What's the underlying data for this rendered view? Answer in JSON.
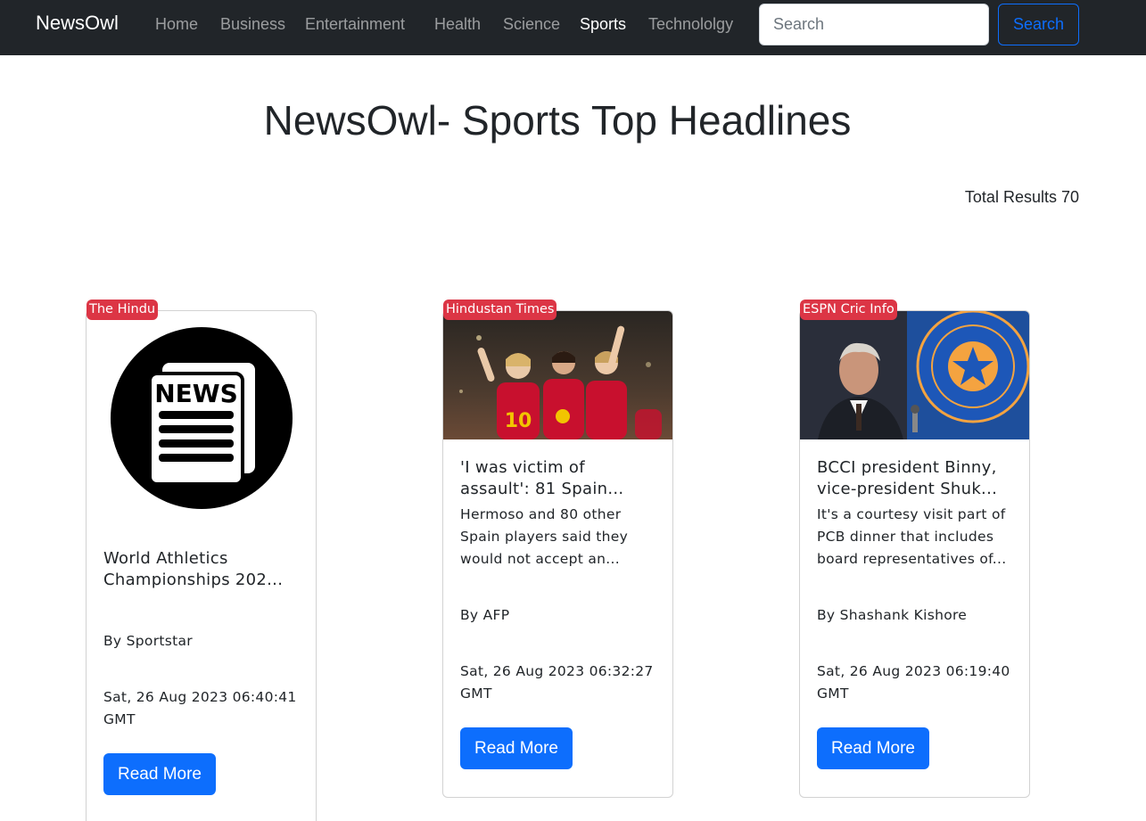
{
  "navbar": {
    "brand": "NewsOwl",
    "links": [
      {
        "label": "Home"
      },
      {
        "label": "Business"
      },
      {
        "label": "Entertainment"
      },
      {
        "label": "Health"
      },
      {
        "label": "Science"
      },
      {
        "label": "Sports",
        "active": true
      },
      {
        "label": "Technololgy"
      }
    ],
    "search_placeholder": "Search",
    "search_value": "",
    "search_button": "Search"
  },
  "page": {
    "title": "NewsOwl- Sports Top Headlines",
    "total_results": "Total Results 70"
  },
  "articles": [
    {
      "source": "The Hindu",
      "image": "news-placeholder-icon",
      "title_line1": "World Athletics",
      "title_line2": "Championships 202...",
      "description": "",
      "author": "By Sportstar",
      "date_line1": "Sat, 26 Aug 2023 06:40:41",
      "date_line2": "GMT",
      "button": "Read More"
    },
    {
      "source": "Hindustan Times",
      "image": "spain-football-players-celebrating-photo",
      "title_line1": "'I was victim of",
      "title_line2": "assault': 81 Spain...",
      "desc_line1": "Hermoso and 80 other",
      "desc_line2": "Spain players said they",
      "desc_line3": "would not accept an...",
      "author": "By AFP",
      "date_line1": "Sat, 26 Aug 2023 06:32:27",
      "date_line2": "GMT",
      "button": "Read More"
    },
    {
      "source": "ESPN Cric Info",
      "image": "bcci-official-press-conference-photo",
      "title_line1": "BCCI president Binny,",
      "title_line2": "vice-president Shuk...",
      "desc_line1": "It's a courtesy visit part of",
      "desc_line2": "PCB dinner that includes",
      "desc_line3": "board representatives of...",
      "author": "By Shashank Kishore",
      "date_line1": "Sat, 26 Aug 2023 06:19:40",
      "date_line2": "GMT",
      "button": "Read More"
    }
  ],
  "colors": {
    "navbar_bg": "#212529",
    "badge": "#dc3545",
    "primary": "#0d6efd"
  }
}
